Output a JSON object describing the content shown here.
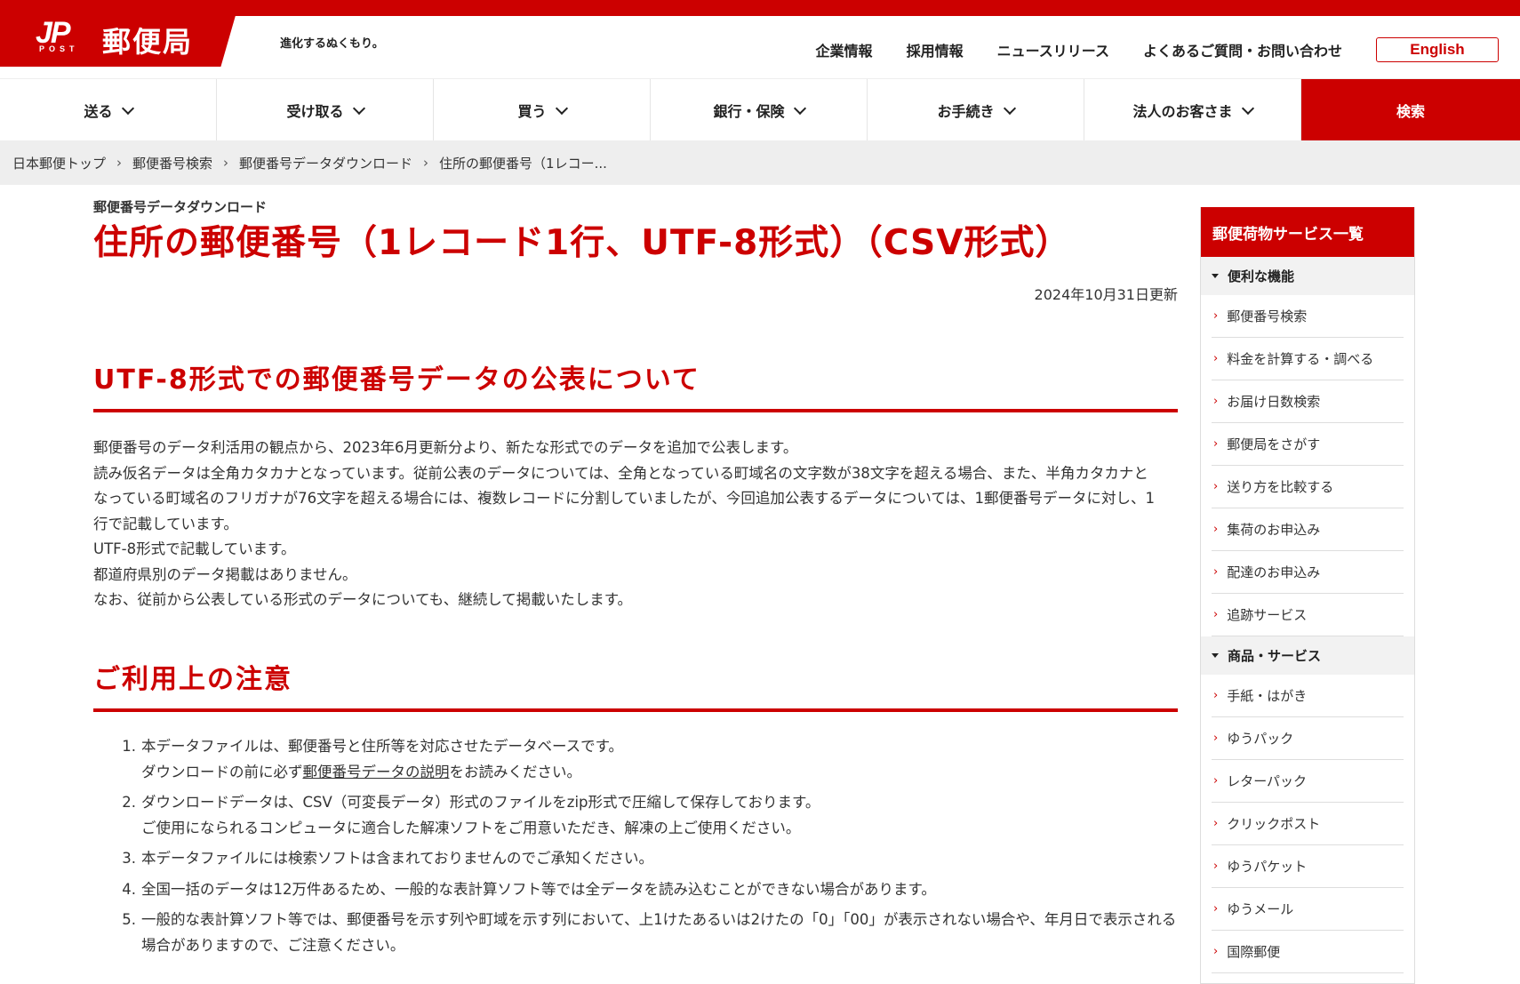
{
  "header": {
    "logo_mark": "JP",
    "logo_post": "POST",
    "logo_name": "郵便局",
    "tagline": "進化するぬくもり。",
    "utility_links": [
      "企業情報",
      "採用情報",
      "ニュースリリース",
      "よくあるご質問・お問い合わせ"
    ],
    "english_label": "English"
  },
  "nav": {
    "items": [
      "送る",
      "受け取る",
      "買う",
      "銀行・保険",
      "お手続き",
      "法人のお客さま"
    ],
    "search_label": "検索"
  },
  "breadcrumb": [
    "日本郵便トップ",
    "郵便番号検索",
    "郵便番号データダウンロード",
    "住所の郵便番号（1レコー..."
  ],
  "page": {
    "kicker": "郵便番号データダウンロード",
    "title": "住所の郵便番号（1レコード1行、UTF-8形式）（CSV形式）",
    "updated": "2024年10月31日更新",
    "section1_title": "UTF-8形式での郵便番号データの公表について",
    "section1_paragraphs": [
      "郵便番号のデータ利活用の観点から、2023年6月更新分より、新たな形式でのデータを追加で公表します。",
      "読み仮名データは全角カタカナとなっています。従前公表のデータについては、全角となっている町域名の文字数が38文字を超える場合、また、半角カタカナとなっている町域名のフリガナが76文字を超える場合には、複数レコードに分割していましたが、今回追加公表するデータについては、1郵便番号データに対し、1行で記載しています。",
      "UTF-8形式で記載しています。",
      "都道府県別のデータ掲載はありません。",
      "なお、従前から公表している形式のデータについても、継続して掲載いたします。"
    ],
    "section2_title": "ご利用上の注意",
    "notes": [
      {
        "num": "1.",
        "line1": "本データファイルは、郵便番号と住所等を対応させたデータベースです。",
        "line2_pre": "ダウンロードの前に必ず",
        "line2_link": "郵便番号データの説明",
        "line2_post": "をお読みください。"
      },
      {
        "num": "2.",
        "line1": "ダウンロードデータは、CSV（可変長データ）形式のファイルをzip形式で圧縮して保存しております。",
        "line2": "ご使用になられるコンピュータに適合した解凍ソフトをご用意いただき、解凍の上ご使用ください。"
      },
      {
        "num": "3.",
        "line1": "本データファイルには検索ソフトは含まれておりませんのでご承知ください。"
      },
      {
        "num": "4.",
        "line1": "全国一括のデータは12万件あるため、一般的な表計算ソフト等では全データを読み込むことができない場合があります。"
      },
      {
        "num": "5.",
        "line1": "一般的な表計算ソフト等では、郵便番号を示す列や町域を示す列において、上1けたあるいは2けたの「0」「00」が表示されない場合や、年月日で表示される場合がありますので、ご注意ください。"
      }
    ]
  },
  "sidebar": {
    "title": "郵便荷物サービス一覧",
    "group1": "便利な機能",
    "group1_links": [
      "郵便番号検索",
      "料金を計算する・調べる",
      "お届け日数検索",
      "郵便局をさがす",
      "送り方を比較する",
      "集荷のお申込み",
      "配達のお申込み",
      "追跡サービス"
    ],
    "group2": "商品・サービス",
    "group2_links": [
      "手紙・はがき",
      "ゆうパック",
      "レターパック",
      "クリックポスト",
      "ゆうパケット",
      "ゆうメール",
      "国際郵便"
    ]
  },
  "colors": {
    "brand_red": "#cc0000",
    "breadcrumb_bg": "#eeeeee"
  }
}
